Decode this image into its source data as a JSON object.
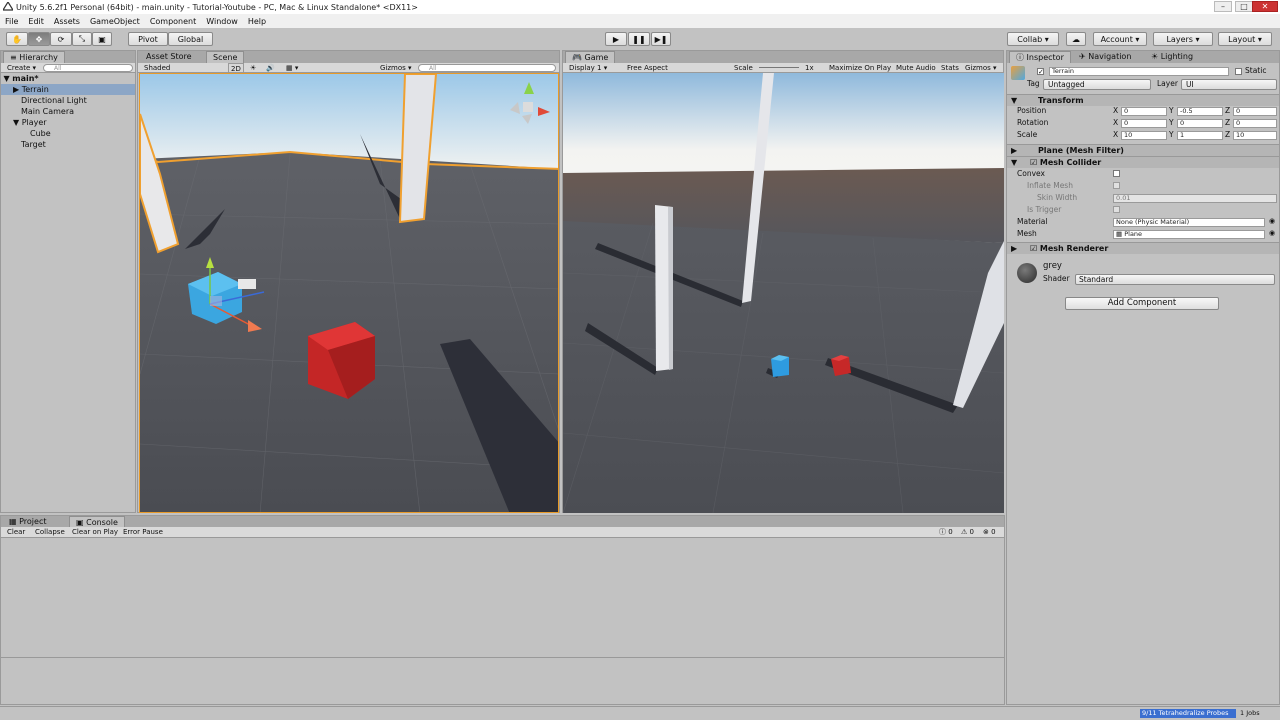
{
  "window": {
    "title": "Unity 5.6.2f1 Personal (64bit) - main.unity - Tutorial-Youtube - PC, Mac & Linux Standalone* <DX11>"
  },
  "menu": [
    "File",
    "Edit",
    "Assets",
    "GameObject",
    "Component",
    "Window",
    "Help"
  ],
  "toolbar": {
    "pivot": "Pivot",
    "global": "Global",
    "collab": "Collab ▾",
    "account": "Account",
    "layers": "Layers",
    "layout": "Layout"
  },
  "hierarchy": {
    "tab": "Hierarchy",
    "create": "Create",
    "search_placeholder": "All",
    "scene": "main*",
    "items": [
      "Terrain",
      "Directional Light",
      "Main Camera",
      "Player",
      "Cube",
      "Target"
    ]
  },
  "scene": {
    "tab_store": "Asset Store",
    "tab_scene": "Scene",
    "shaded": "Shaded",
    "mode2d": "2D",
    "gizmos": "Gizmos",
    "search_placeholder": "All"
  },
  "game": {
    "tab": "Game",
    "display": "Display 1",
    "aspect": "Free Aspect",
    "scale_label": "Scale",
    "scale_value": "1x",
    "max": "Maximize On Play",
    "mute": "Mute Audio",
    "stats": "Stats",
    "gizmos": "Gizmos"
  },
  "inspector": {
    "tab": "Inspector",
    "tab_nav": "Navigation",
    "tab_light": "Lighting",
    "name": "Terrain",
    "static": "Static",
    "tag_label": "Tag",
    "tag": "Untagged",
    "layer_label": "Layer",
    "layer": "UI",
    "transform": {
      "title": "Transform",
      "position": "Position",
      "rotation": "Rotation",
      "scale": "Scale",
      "pos": [
        "0",
        "-0.5",
        "0"
      ],
      "rot": [
        "0",
        "0",
        "0"
      ],
      "scl": [
        "10",
        "1",
        "10"
      ]
    },
    "mesh_filter": "Plane (Mesh Filter)",
    "mesh_collider": {
      "title": "Mesh Collider",
      "convex": "Convex",
      "inflate": "Inflate Mesh",
      "skin": "Skin Width",
      "skin_value": "0.01",
      "trigger": "Is Trigger",
      "material": "Material",
      "material_value": "None (Physic Material)",
      "mesh": "Mesh",
      "mesh_value": "Plane"
    },
    "mesh_renderer": "Mesh Renderer",
    "material": {
      "name": "grey",
      "shader_label": "Shader",
      "shader": "Standard"
    },
    "add_component": "Add Component"
  },
  "console": {
    "tab_project": "Project",
    "tab_console": "Console",
    "clear": "Clear",
    "collapse": "Collapse",
    "clear_on_play": "Clear on Play",
    "error_pause": "Error Pause",
    "counts": [
      "0",
      "0",
      "0"
    ]
  },
  "status": {
    "probes": "9/11 Tetrahedralize Probes",
    "jobs": "1 Jobs"
  },
  "axes": {
    "x": "X",
    "y": "Y",
    "z": "Z"
  }
}
